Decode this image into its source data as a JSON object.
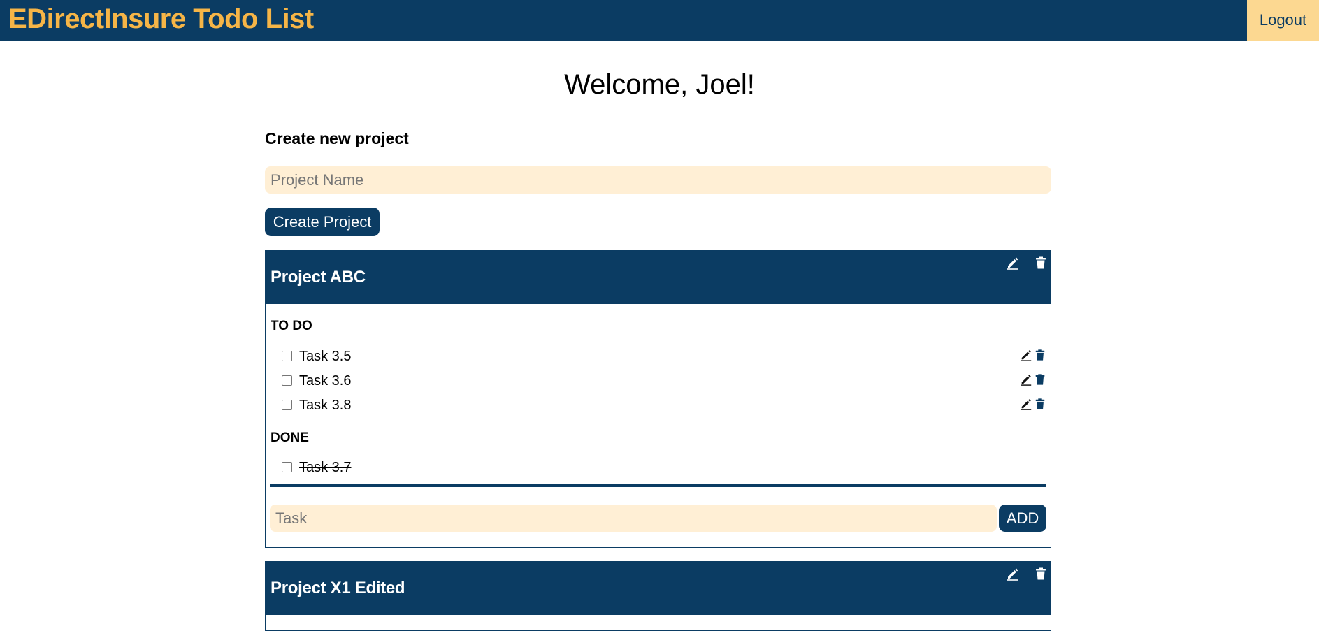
{
  "header": {
    "brand": "EDirectInsure Todo List",
    "logout_label": "Logout"
  },
  "welcome": "Welcome, Joel!",
  "create_project": {
    "heading": "Create new project",
    "input_placeholder": "Project Name",
    "button_label": "Create Project"
  },
  "colors": {
    "primary": "#0b3c63",
    "brand_text": "#f6b547",
    "logout_bg": "#fcd891",
    "input_bg": "#ffefd5"
  },
  "projects": [
    {
      "name": "Project ABC",
      "todo_label": "TO DO",
      "todo": [
        {
          "label": "Task 3.5",
          "done": false
        },
        {
          "label": "Task 3.6",
          "done": false
        },
        {
          "label": "Task 3.8",
          "done": false
        }
      ],
      "done_label": "DONE",
      "done": [
        {
          "label": "Task 3.7",
          "done": true
        }
      ],
      "task_placeholder": "Task",
      "add_label": "ADD"
    },
    {
      "name": "Project X1 Edited"
    }
  ],
  "icons": {
    "edit": "pencil-icon",
    "delete": "trash-icon"
  }
}
